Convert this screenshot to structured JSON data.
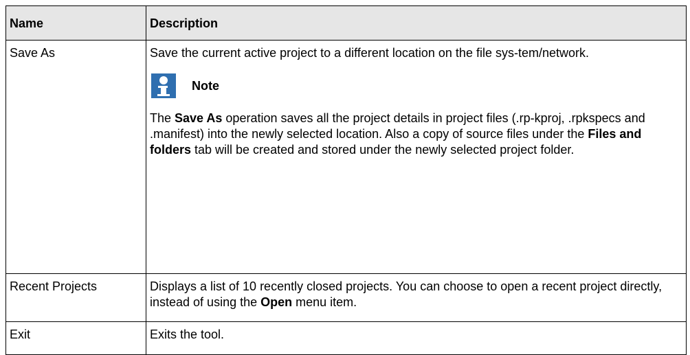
{
  "table": {
    "headers": {
      "name": "Name",
      "description": "Description"
    },
    "rows": [
      {
        "name": "Save As",
        "description_line": "Save the current active project to a different location on the file sys-tem/network.",
        "note": {
          "icon": "info-icon",
          "label": "Note"
        },
        "note_text": {
          "p1": "The ",
          "b1": "Save As",
          "p2": " operation saves all the project details in project files (.rp-kproj, .rpkspecs and .manifest) into the newly selected location. Also a copy of source files under the ",
          "b2": "Files and folders",
          "p3": " tab will be created and stored under the newly selected project folder."
        }
      },
      {
        "name": "Recent Projects",
        "desc": {
          "p1": "Displays a list of 10 recently closed projects. You can choose to open a recent project directly, instead of using the ",
          "b1": "Open",
          "p2": " menu item."
        }
      },
      {
        "name": "Exit",
        "description": "Exits the tool."
      }
    ]
  },
  "colors": {
    "header_bg": "#e6e6e6",
    "note_icon": "#2f6fb0",
    "border": "#000000"
  }
}
